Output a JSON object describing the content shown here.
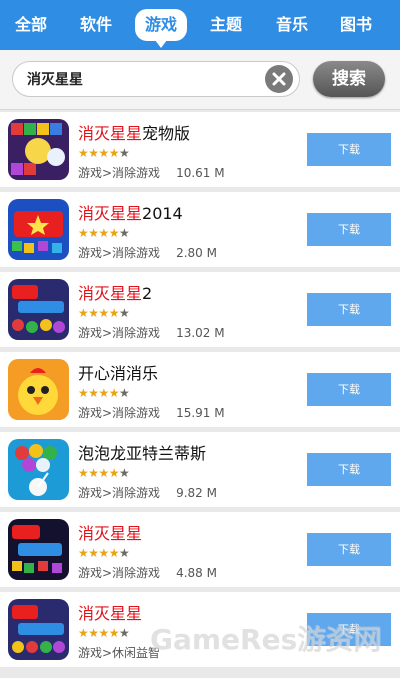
{
  "nav": {
    "tabs": [
      {
        "label": "全部"
      },
      {
        "label": "软件"
      },
      {
        "label": "游戏",
        "active": true
      },
      {
        "label": "主题"
      },
      {
        "label": "音乐"
      },
      {
        "label": "图书"
      }
    ]
  },
  "search": {
    "value": "消灭星星",
    "button_label": "搜索"
  },
  "results": [
    {
      "name_highlight": "消灭星星",
      "name_rest": "宠物版",
      "rating": 4,
      "category": "游戏>消除游戏",
      "size": "10.61 M",
      "button": "下载"
    },
    {
      "name_highlight": "消灭星星",
      "name_rest": "2014",
      "rating": 4,
      "category": "游戏>消除游戏",
      "size": "2.80 M",
      "button": "下载"
    },
    {
      "name_highlight": "消灭星星",
      "name_rest": "2",
      "rating": 4,
      "category": "游戏>消除游戏",
      "size": "13.02 M",
      "button": "下载"
    },
    {
      "name_highlight": "",
      "name_rest": "开心消消乐",
      "rating": 4,
      "category": "游戏>消除游戏",
      "size": "15.91 M",
      "button": "下载"
    },
    {
      "name_highlight": "",
      "name_rest": "泡泡龙亚特兰蒂斯",
      "rating": 4,
      "category": "游戏>消除游戏",
      "size": "9.82 M",
      "button": "下载"
    },
    {
      "name_highlight": "消灭星星",
      "name_rest": "",
      "rating": 4,
      "category": "游戏>消除游戏",
      "size": "4.88 M",
      "button": "下载"
    },
    {
      "name_highlight": "消灭星星",
      "name_rest": "",
      "rating": 4,
      "category": "游戏>休闲益智",
      "size": "",
      "button": "下载"
    }
  ],
  "watermark": "GameRes游资网",
  "colors": {
    "nav_bg": "#2f8de4",
    "download_button": "#5fa8ee",
    "highlight_text": "#e0121a",
    "star": "#e8a317"
  }
}
